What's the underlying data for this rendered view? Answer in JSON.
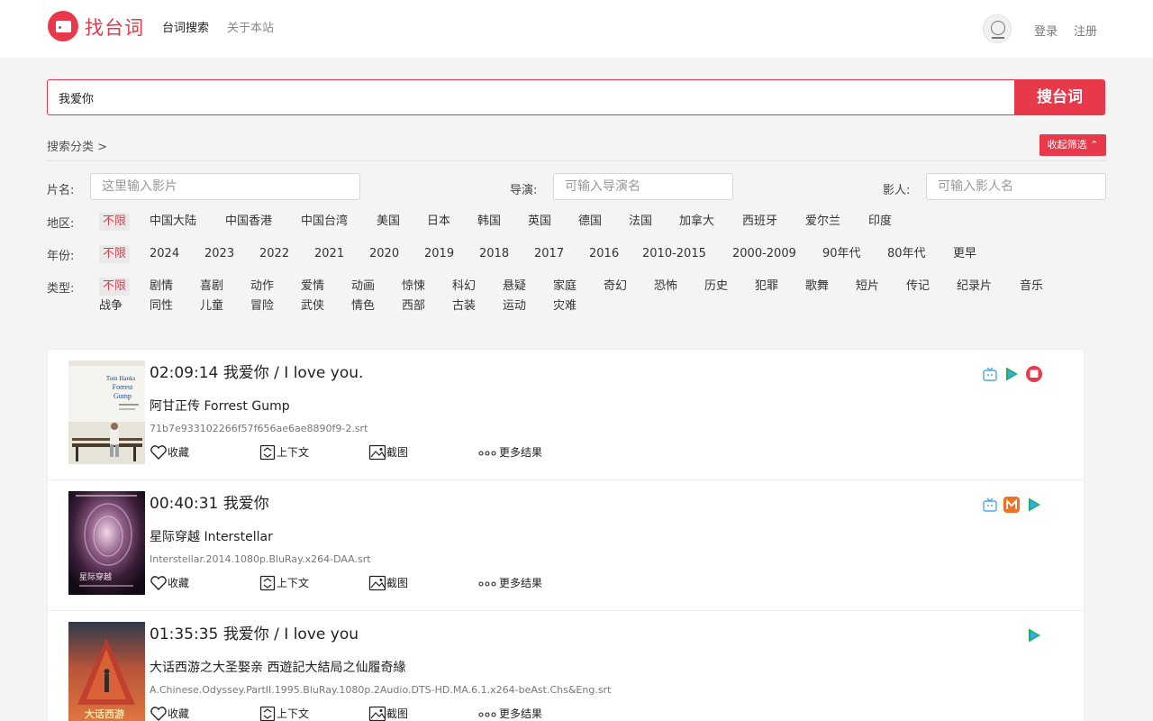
{
  "header": {
    "logo_text": "找台词",
    "nav": [
      "台词搜索",
      "关于本站"
    ],
    "login": "登录",
    "register": "注册"
  },
  "search": {
    "value": "我爱你",
    "button": "搜台词"
  },
  "filter": {
    "title": "搜索分类 >",
    "collapse": "收起筛选 ⌃",
    "title_label": "片名:",
    "title_placeholder": "这里输入影片",
    "director_label": "导演:",
    "director_placeholder": "可输入导演名",
    "actor_label": "影人:",
    "actor_placeholder": "可输入影人名",
    "region_label": "地区:",
    "regions": [
      "不限",
      "中国大陆",
      "中国香港",
      "中国台湾",
      "美国",
      "日本",
      "韩国",
      "英国",
      "德国",
      "法国",
      "加拿大",
      "西班牙",
      "爱尔兰",
      "印度"
    ],
    "year_label": "年份:",
    "years": [
      "不限",
      "2024",
      "2023",
      "2022",
      "2021",
      "2020",
      "2019",
      "2018",
      "2017",
      "2016",
      "2010-2015",
      "2000-2009",
      "90年代",
      "80年代",
      "更早"
    ],
    "genre_label": "类型:",
    "genres_row1": [
      "不限",
      "剧情",
      "喜剧",
      "动作",
      "爱情",
      "动画",
      "惊悚",
      "科幻",
      "悬疑",
      "家庭",
      "奇幻",
      "恐怖",
      "历史",
      "犯罪",
      "歌舞",
      "短片",
      "传记",
      "纪录片",
      "音乐"
    ],
    "genres_row2": [
      "战争",
      "同性",
      "儿童",
      "冒险",
      "武侠",
      "情色",
      "西部",
      "古装",
      "运动",
      "灾难"
    ]
  },
  "actions": {
    "favorite": "收藏",
    "context": "上下文",
    "screenshot": "截图",
    "more": "更多结果"
  },
  "results": [
    {
      "title": "02:09:14 我爱你 / I love you.",
      "movie": "阿甘正传 Forrest Gump",
      "file": "71b7e933102266f57f656ae6ae8890f9-2.srt",
      "poster_text": "Tom Hanks Forrest Gump",
      "sources": [
        "tv-icon",
        "play-icon",
        "film-icon"
      ]
    },
    {
      "title": "00:40:31 我爱你",
      "movie": "星际穿越 Interstellar",
      "file": "Interstellar.2014.1080p.BluRay.x264-DAA.srt",
      "poster_text": "星际穿越",
      "sources": [
        "tv-icon",
        "mango-icon",
        "play-icon"
      ]
    },
    {
      "title": "01:35:35 我爱你 / I love you",
      "movie": "大话西游之大圣娶亲 西遊記大結局之仙履奇緣",
      "file": "A.Chinese.Odyssey.PartII.1995.BluRay.1080p.2Audio.DTS-HD.MA.6.1.x264-beAst.Chs&Eng.srt",
      "poster_text": "大话西游",
      "sources": [
        "play-icon"
      ]
    }
  ],
  "colors": {
    "accent": "#e8394a",
    "background": "#f4f4f4"
  }
}
